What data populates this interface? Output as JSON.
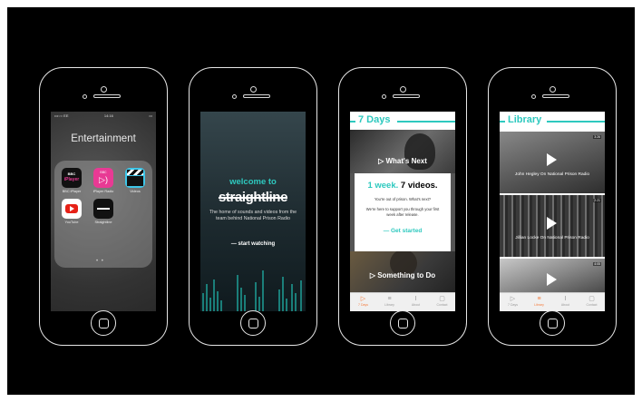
{
  "phone1": {
    "status_left": "•••○○ EE",
    "status_time": "14:16",
    "folder_title": "Entertainment",
    "apps": [
      {
        "name": "BBC iPlayer",
        "icon": "bbc-iplayer-icon",
        "color": "#111111",
        "text": "iPlayer"
      },
      {
        "name": "iPlayer Radio",
        "icon": "iplayer-radio-icon",
        "color": "#e83a94",
        "text": "BBC"
      },
      {
        "name": "Videos",
        "icon": "clapperboard-icon",
        "color": "#3ec6e8",
        "text": ""
      },
      {
        "name": "YouTube",
        "icon": "youtube-icon",
        "color": "#ffffff",
        "text": ""
      },
      {
        "name": "Straightline",
        "icon": "straightline-icon",
        "color": "#111111",
        "text": ""
      }
    ]
  },
  "phone2": {
    "welcome": "welcome to",
    "brand": "straightline",
    "description": "The home of sounds and videos from the team behind National Prison Radio",
    "cta": "— start watching"
  },
  "phone3": {
    "title": "7 Days",
    "panel_top": "▷ What's Next",
    "popup_heading_accent": "1 week.",
    "popup_heading": "7 videos.",
    "popup_line1": "You're out of prison. What's next?",
    "popup_line2": "We're here to support you through your first week after release.",
    "popup_cta": "— Get started",
    "panel_bottom": "▷ Something to Do",
    "tabs": [
      "7 Days",
      "Library",
      "About",
      "Contact"
    ]
  },
  "phone4": {
    "title": "Library",
    "videos": [
      {
        "title": "John Hegley On National Prison Radio",
        "duration": "3:26"
      },
      {
        "title": "Jillian Locke On National Prison Radio",
        "duration": "2:21"
      },
      {
        "title": "",
        "duration": "4:05"
      }
    ],
    "tabs": [
      "7 Days",
      "Library",
      "About",
      "Contact"
    ]
  },
  "colors": {
    "accent": "#2ec9bf",
    "tab_active": "#f47b3c",
    "background": "#000000"
  }
}
